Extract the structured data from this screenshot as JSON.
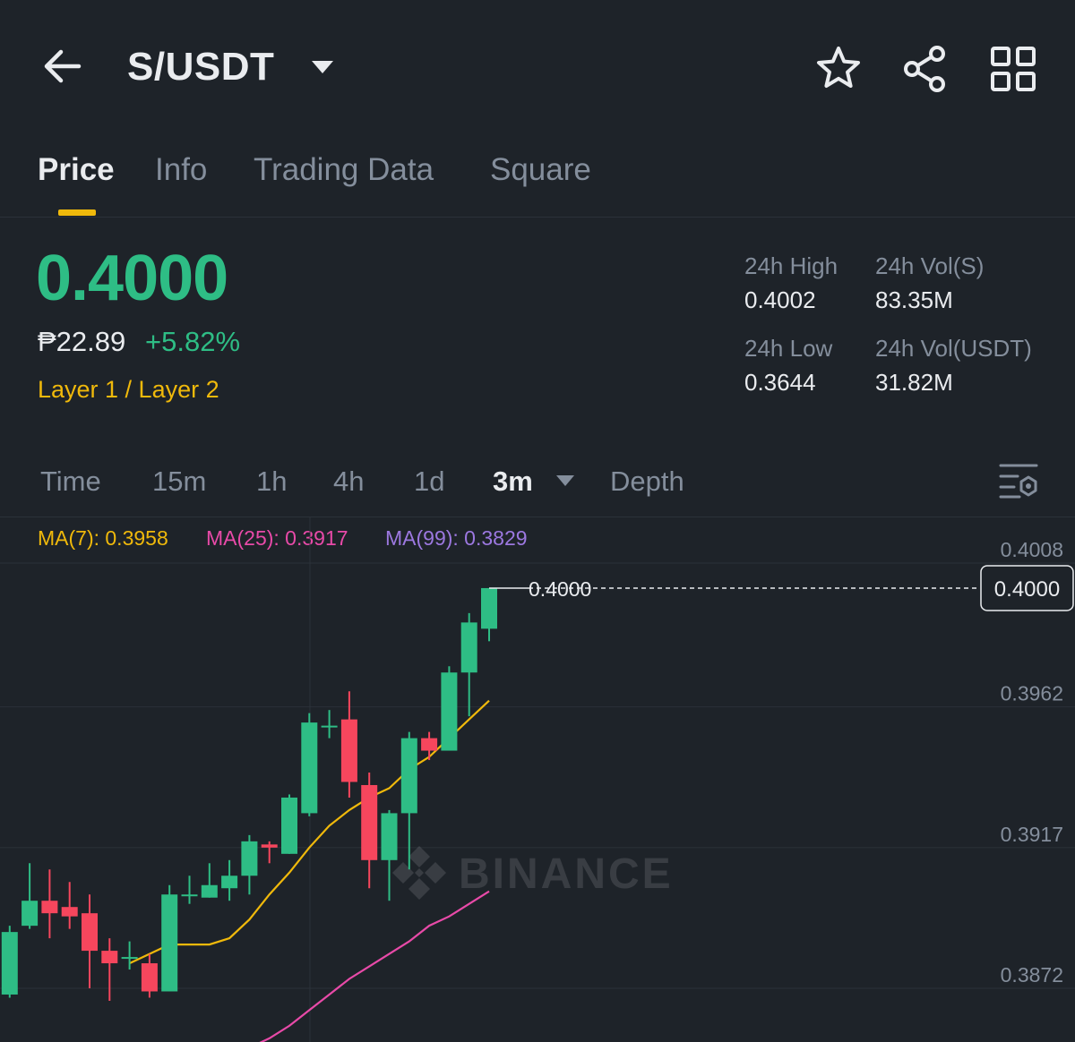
{
  "header": {
    "pair": "S/USDT",
    "icons": [
      "back-arrow-icon",
      "caret-down-icon",
      "star-icon",
      "share-icon",
      "grid-icon"
    ]
  },
  "tabs": [
    {
      "label": "Price",
      "active": true
    },
    {
      "label": "Info",
      "active": false
    },
    {
      "label": "Trading Data",
      "active": false
    },
    {
      "label": "Square",
      "active": false
    }
  ],
  "price": {
    "last": "0.4000",
    "fiat": "₱22.89",
    "change": "+5.82%",
    "category": "Layer 1 / Layer 2"
  },
  "stats": {
    "high_label": "24h High",
    "high": "0.4002",
    "low_label": "24h Low",
    "low": "0.3644",
    "vol_base_label": "24h Vol(S)",
    "vol_base": "83.35M",
    "vol_quote_label": "24h Vol(USDT)",
    "vol_quote": "31.82M"
  },
  "intervals": {
    "time": "Time",
    "m15": "15m",
    "h1": "1h",
    "h4": "4h",
    "d1": "1d",
    "m3": "3m",
    "depth": "Depth",
    "selected": "3m"
  },
  "ma": {
    "ma7": "MA(7): 0.3958",
    "ma25": "MA(25): 0.3917",
    "ma99": "MA(99): 0.3829"
  },
  "colors": {
    "background": "#1e2329",
    "up": "#2ebd85",
    "down": "#f6465d",
    "accent": "#f0b90b",
    "ma7": "#f0b90b",
    "ma25": "#e84aa8",
    "ma99": "#9c78e0"
  },
  "chart_data": {
    "type": "candlestick",
    "y_ticks": [
      "0.4008",
      "0.3962",
      "0.3917",
      "0.3872"
    ],
    "last_price_label": "0.4000",
    "last_price_tag": "0.4000",
    "watermark": "BINANCE",
    "ylim": [
      0.3855,
      0.4016
    ],
    "candles": [
      {
        "o": 0.387,
        "c": 0.389,
        "h": 0.3892,
        "l": 0.3869
      },
      {
        "o": 0.3892,
        "c": 0.39,
        "h": 0.3912,
        "l": 0.3891
      },
      {
        "o": 0.39,
        "c": 0.3896,
        "h": 0.391,
        "l": 0.3888
      },
      {
        "o": 0.3898,
        "c": 0.3895,
        "h": 0.3906,
        "l": 0.3891
      },
      {
        "o": 0.3896,
        "c": 0.3884,
        "h": 0.3902,
        "l": 0.3872
      },
      {
        "o": 0.3884,
        "c": 0.388,
        "h": 0.3888,
        "l": 0.3868
      },
      {
        "o": 0.3882,
        "c": 0.3882,
        "h": 0.3887,
        "l": 0.3878
      },
      {
        "o": 0.388,
        "c": 0.3871,
        "h": 0.3883,
        "l": 0.3869
      },
      {
        "o": 0.3871,
        "c": 0.3902,
        "h": 0.3905,
        "l": 0.3871
      },
      {
        "o": 0.3902,
        "c": 0.3902,
        "h": 0.3908,
        "l": 0.3899
      },
      {
        "o": 0.3901,
        "c": 0.3905,
        "h": 0.3912,
        "l": 0.3901
      },
      {
        "o": 0.3904,
        "c": 0.3908,
        "h": 0.3913,
        "l": 0.39
      },
      {
        "o": 0.3908,
        "c": 0.3919,
        "h": 0.3921,
        "l": 0.3902
      },
      {
        "o": 0.3918,
        "c": 0.3917,
        "h": 0.3919,
        "l": 0.3912
      },
      {
        "o": 0.3915,
        "c": 0.3933,
        "h": 0.3934,
        "l": 0.3915
      },
      {
        "o": 0.3928,
        "c": 0.3957,
        "h": 0.396,
        "l": 0.3927
      },
      {
        "o": 0.3956,
        "c": 0.3956,
        "h": 0.3961,
        "l": 0.3952
      },
      {
        "o": 0.3958,
        "c": 0.3938,
        "h": 0.3967,
        "l": 0.3933
      },
      {
        "o": 0.3937,
        "c": 0.3913,
        "h": 0.3941,
        "l": 0.3904
      },
      {
        "o": 0.3913,
        "c": 0.3928,
        "h": 0.3929,
        "l": 0.39
      },
      {
        "o": 0.3928,
        "c": 0.3952,
        "h": 0.3954,
        "l": 0.391
      },
      {
        "o": 0.3952,
        "c": 0.3948,
        "h": 0.3954,
        "l": 0.3945
      },
      {
        "o": 0.3948,
        "c": 0.3973,
        "h": 0.3975,
        "l": 0.3948
      },
      {
        "o": 0.3973,
        "c": 0.3989,
        "h": 0.3992,
        "l": 0.3959
      },
      {
        "o": 0.3987,
        "c": 0.4,
        "h": 0.4,
        "l": 0.3983
      }
    ],
    "series": [
      {
        "name": "MA(7)",
        "values": [
          null,
          null,
          null,
          null,
          null,
          null,
          0.388,
          0.3883,
          0.3886,
          0.3886,
          0.3886,
          0.3888,
          0.3894,
          0.3902,
          0.3909,
          0.3917,
          0.3924,
          0.3929,
          0.3933,
          0.3936,
          0.3942,
          0.3946,
          0.3952,
          0.3958,
          0.3964
        ]
      },
      {
        "name": "MA(25)",
        "values": [
          null,
          null,
          null,
          null,
          null,
          null,
          null,
          null,
          null,
          null,
          null,
          null,
          0.3853,
          0.3856,
          0.386,
          0.3865,
          0.387,
          0.3875,
          0.3879,
          0.3883,
          0.3887,
          0.3892,
          0.3895,
          0.3899,
          0.3903
        ]
      }
    ]
  }
}
